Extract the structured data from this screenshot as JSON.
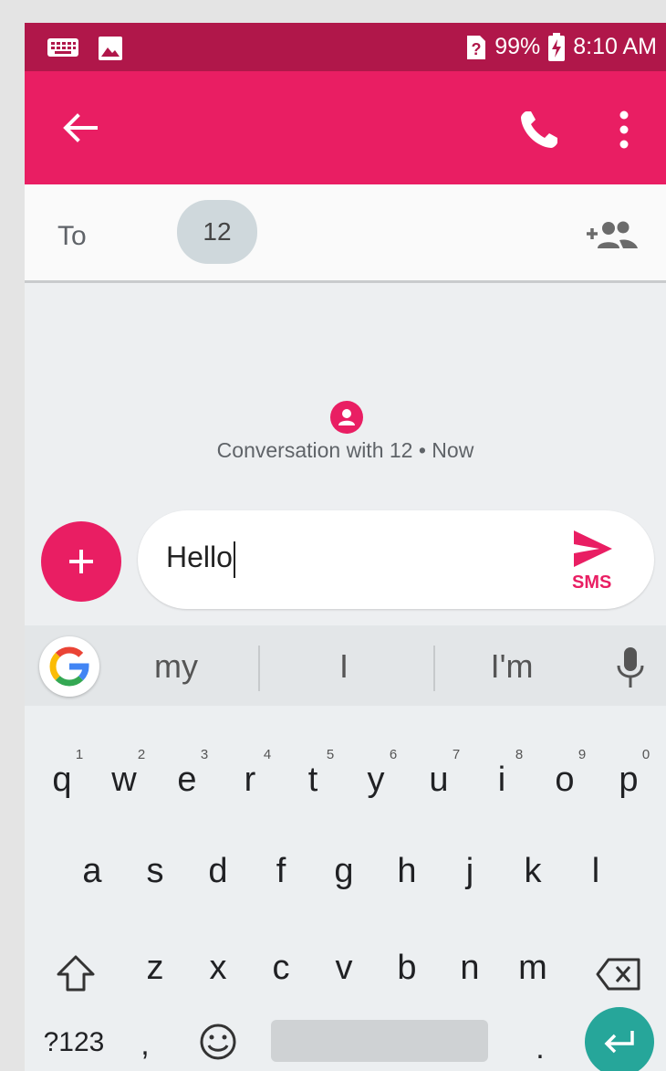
{
  "status_bar": {
    "keyboard_icon": "keyboard-icon",
    "image_icon": "image-icon",
    "sim_icon": "no-sim-icon",
    "battery_percent": "99%",
    "battery_icon": "battery-charging-icon",
    "time": "8:10 AM"
  },
  "app_bar": {
    "back_icon": "arrow-back-icon",
    "call_icon": "phone-icon",
    "more_icon": "more-vert-icon",
    "color": "#e91e63"
  },
  "recipients": {
    "to_label": "To",
    "chip_label": "12",
    "add_people_icon": "add-group-icon"
  },
  "conversation": {
    "info_text": "Conversation with 12 • Now",
    "avatar_icon": "person-icon"
  },
  "compose": {
    "attach_icon": "plus-icon",
    "message_text": "Hello",
    "send_icon": "send-icon",
    "send_mode_label": "SMS"
  },
  "keyboard": {
    "google_icon": "google-g-icon",
    "suggestions": [
      "my",
      "I",
      "I'm"
    ],
    "mic_icon": "microphone-icon",
    "row1": [
      "q",
      "w",
      "e",
      "r",
      "t",
      "y",
      "u",
      "i",
      "o",
      "p"
    ],
    "row1_hints": [
      "1",
      "2",
      "3",
      "4",
      "5",
      "6",
      "7",
      "8",
      "9",
      "0"
    ],
    "row2": [
      "a",
      "s",
      "d",
      "f",
      "g",
      "h",
      "j",
      "k",
      "l"
    ],
    "row3": [
      "z",
      "x",
      "c",
      "v",
      "b",
      "n",
      "m"
    ],
    "shift_icon": "shift-icon",
    "backspace_icon": "backspace-icon",
    "symbols_label": "?123",
    "comma_label": ",",
    "emoji_icon": "emoji-icon",
    "period_label": ".",
    "enter_icon": "enter-icon",
    "enter_color": "#26a69a"
  }
}
